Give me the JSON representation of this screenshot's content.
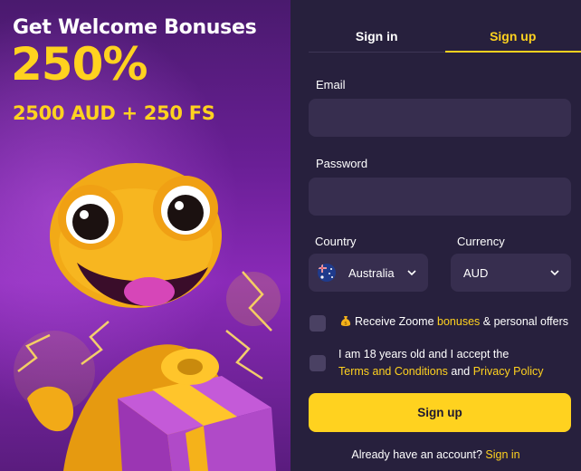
{
  "promo": {
    "title": "Get Welcome Bonuses",
    "percent": "250%",
    "subtitle": "2500 AUD + 250 FS"
  },
  "tabs": [
    {
      "label": "Sign in",
      "active": false
    },
    {
      "label": "Sign up",
      "active": true
    }
  ],
  "form": {
    "email_label": "Email",
    "email_value": "",
    "password_label": "Password",
    "password_value": "",
    "country_label": "Country",
    "country_value": "Australia",
    "currency_label": "Currency",
    "currency_value": "AUD",
    "bonus_check": {
      "icon": "money-bag-icon",
      "prefix": "Receive Zoome ",
      "link": "bonuses",
      "suffix": " & personal offers",
      "checked": false
    },
    "terms_check": {
      "line1": "I am 18 years old and I accept the",
      "terms_link": "Terms and Conditions",
      "middle": " and ",
      "privacy_link": "Privacy Policy",
      "checked": false
    },
    "submit_label": "Sign up",
    "footer_text": "Already have an account? ",
    "footer_link": "Sign in"
  },
  "colors": {
    "accent": "#ffd21f",
    "panel_bg": "#27203d",
    "input_bg": "#372e4f",
    "promo_purple": "#6a1f96"
  }
}
